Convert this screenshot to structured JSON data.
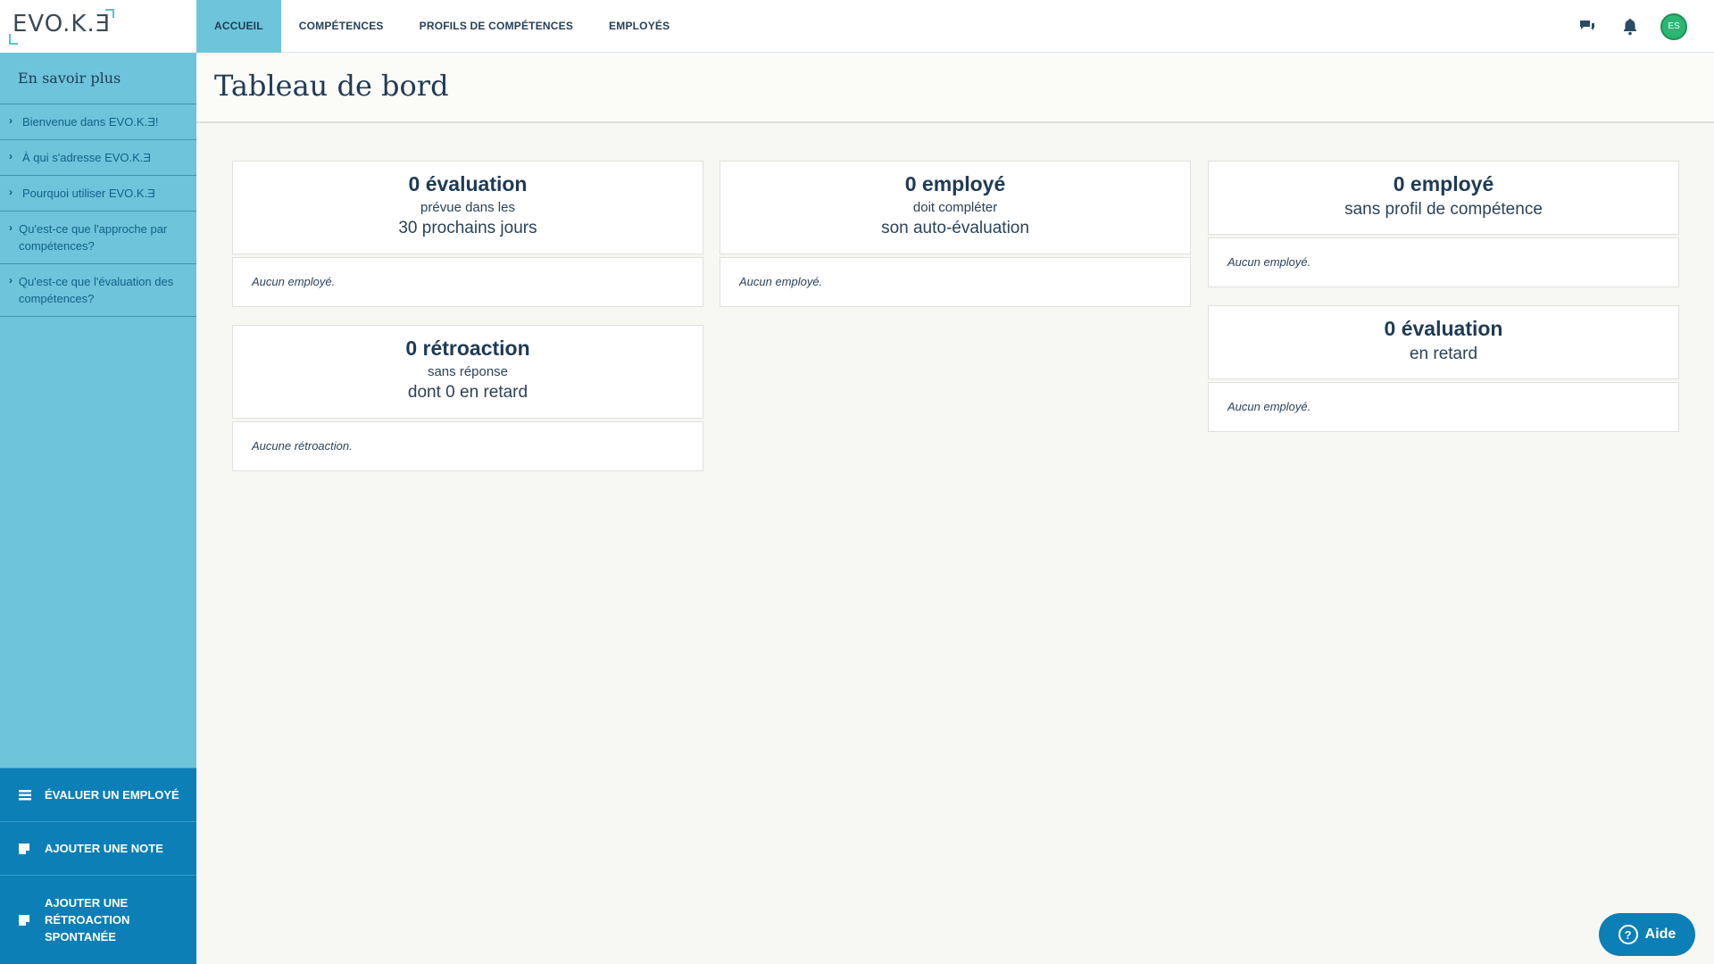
{
  "app": {
    "logo_text": "EVO.K.Ǝ"
  },
  "nav": {
    "items": [
      {
        "label": "ACCUEIL"
      },
      {
        "label": "COMPÉTENCES"
      },
      {
        "label": "PROFILS DE COMPÉTENCES"
      },
      {
        "label": "EMPLOYÉS"
      }
    ]
  },
  "user": {
    "initials": "ES"
  },
  "sidebar": {
    "title": "En savoir plus",
    "links": [
      {
        "label": "Bienvenue dans EVO.K.Ǝ!"
      },
      {
        "label": "À qui s'adresse EVO.K.Ǝ"
      },
      {
        "label": "Pourquoi utiliser EVO.K.Ǝ"
      },
      {
        "label": "Qu'est-ce que l'approche par compétences?"
      },
      {
        "label": "Qu'est-ce que l'évaluation des compétences?"
      }
    ],
    "actions": [
      {
        "label": "ÉVALUER UN EMPLOYÉ"
      },
      {
        "label": "AJOUTER UNE NOTE"
      },
      {
        "label": "AJOUTER UNE RÉTROACTION SPONTANÉE"
      }
    ]
  },
  "page": {
    "title": "Tableau de bord"
  },
  "cards": {
    "upcoming": {
      "big": "0 évaluation",
      "small": "prévue dans les",
      "medium": "30 prochains jours",
      "empty": "Aucun employé."
    },
    "self_eval": {
      "big": "0 employé",
      "small": "doit compléter",
      "medium": "son auto-évaluation",
      "empty": "Aucun employé."
    },
    "no_profile": {
      "big": "0 employé",
      "medium": "sans profil de compétence",
      "empty": "Aucun employé."
    },
    "feedback": {
      "big": "0 rétroaction",
      "small": "sans réponse",
      "medium": "dont 0 en retard",
      "empty": "Aucune rétroaction."
    },
    "late": {
      "big": "0 évaluation",
      "medium": "en retard",
      "empty": "Aucun employé."
    }
  },
  "help": {
    "label": "Aide"
  },
  "colors": {
    "accent": "#6ec4da",
    "primary": "#0b7fb6",
    "avatar": "#2ab673"
  }
}
